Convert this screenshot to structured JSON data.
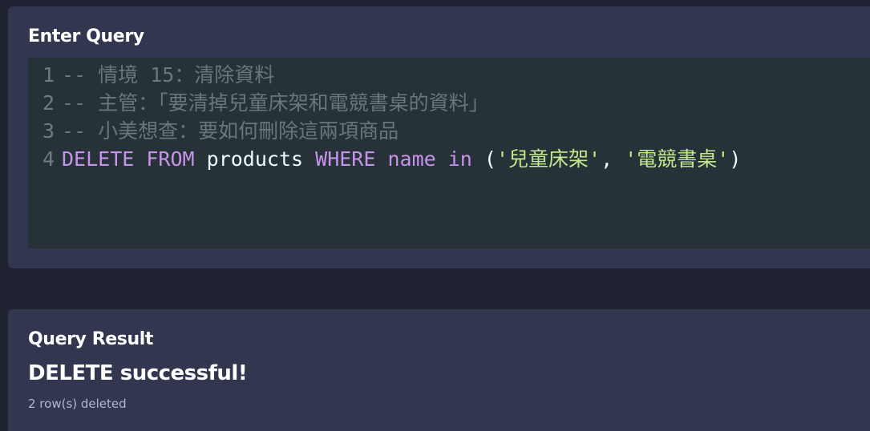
{
  "query_section": {
    "title": "Enter Query",
    "lines": [
      {
        "number": "1",
        "comment": "-- 情境 15：清除資料"
      },
      {
        "number": "2",
        "comment": "-- 主管：「要清掉兒童床架和電競書桌的資料」"
      },
      {
        "number": "3",
        "comment": "-- 小美想查：要如何刪除這兩項商品"
      },
      {
        "number": "4",
        "tokens": {
          "kw_delete": "DELETE",
          "kw_from": "FROM",
          "table": "products",
          "kw_where": "WHERE",
          "column": "name",
          "kw_in": "in",
          "open_paren": "(",
          "value1": "'兒童床架'",
          "comma": ",",
          "value2": "'電競書桌'",
          "close_paren": ")"
        }
      }
    ]
  },
  "result_section": {
    "title": "Query Result",
    "message": "DELETE successful!",
    "detail": "2 row(s) deleted"
  },
  "colors": {
    "background": "#1f2231",
    "panel": "#32364e",
    "editor": "#263238",
    "keyword": "#c792ea",
    "string": "#c3e88d",
    "comment": "#69767b"
  }
}
